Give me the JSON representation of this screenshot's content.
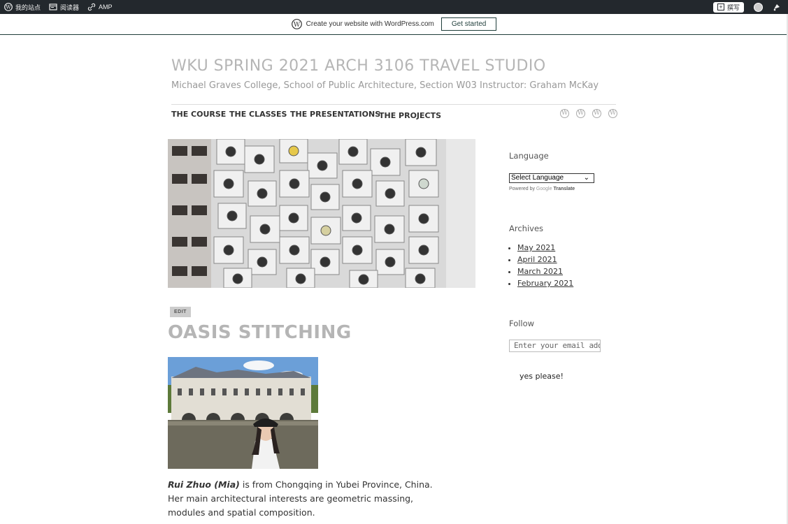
{
  "admin_bar": {
    "my_site": "我的站点",
    "reader": "阅读器",
    "amp": "AMP",
    "write": "撰写"
  },
  "banner": {
    "text": "Create your website with WordPress.com",
    "button": "Get started"
  },
  "site": {
    "title": "WKU SPRING 2021 ARCH 3106 TRAVEL STUDIO",
    "description": "Michael Graves College, School of Public Architecture, Section W03 Instructor: Graham McKay"
  },
  "nav": {
    "items": [
      {
        "label": "THE COURSE"
      },
      {
        "label": "THE CLASSES"
      },
      {
        "label": "THE PRESENTATIONS"
      },
      {
        "label": "THE PROJECTS"
      }
    ],
    "social_icons": [
      "wordpress-icon",
      "wordpress-icon",
      "wordpress-icon",
      "wordpress-icon"
    ]
  },
  "post": {
    "edit_label": "EDIT",
    "title": "OASIS STITCHING",
    "bio_name": "Rui Zhuo (Mia)",
    "bio_text": " is from Chongqing in Yubei Province, China. Her main architectural interests are geometric massing, modules and spatial composition."
  },
  "sidebar": {
    "language_title": "Language",
    "language_select": "Select Language",
    "powered_by": "Powered by",
    "google": "Google",
    "translate": "Translate",
    "archives_title": "Archives",
    "archives": [
      "May 2021",
      "April 2021",
      "March 2021",
      "February 2021"
    ],
    "follow_title": "Follow",
    "email_placeholder": "Enter your email address",
    "follow_button": "yes please!"
  },
  "colors": {
    "admin_bar": "#23282d",
    "banner_border": "#1f3d3a",
    "title_gray": "#b5b5b5"
  }
}
